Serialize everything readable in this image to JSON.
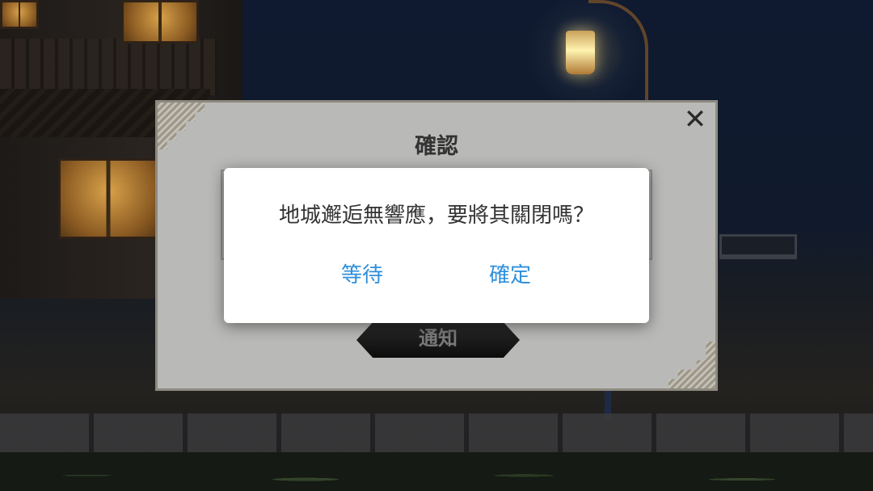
{
  "game_dialog": {
    "title": "確認",
    "close_icon": "close-icon",
    "button_label": "通知"
  },
  "system_dialog": {
    "message": "地城邂逅無響應，要將其關閉嗎？",
    "wait_label": "等待",
    "ok_label": "確定"
  },
  "colors": {
    "accent": "#2f8fdc",
    "dialog_bg": "#ffffff",
    "game_dialog_bg": "#b9b9b7"
  }
}
